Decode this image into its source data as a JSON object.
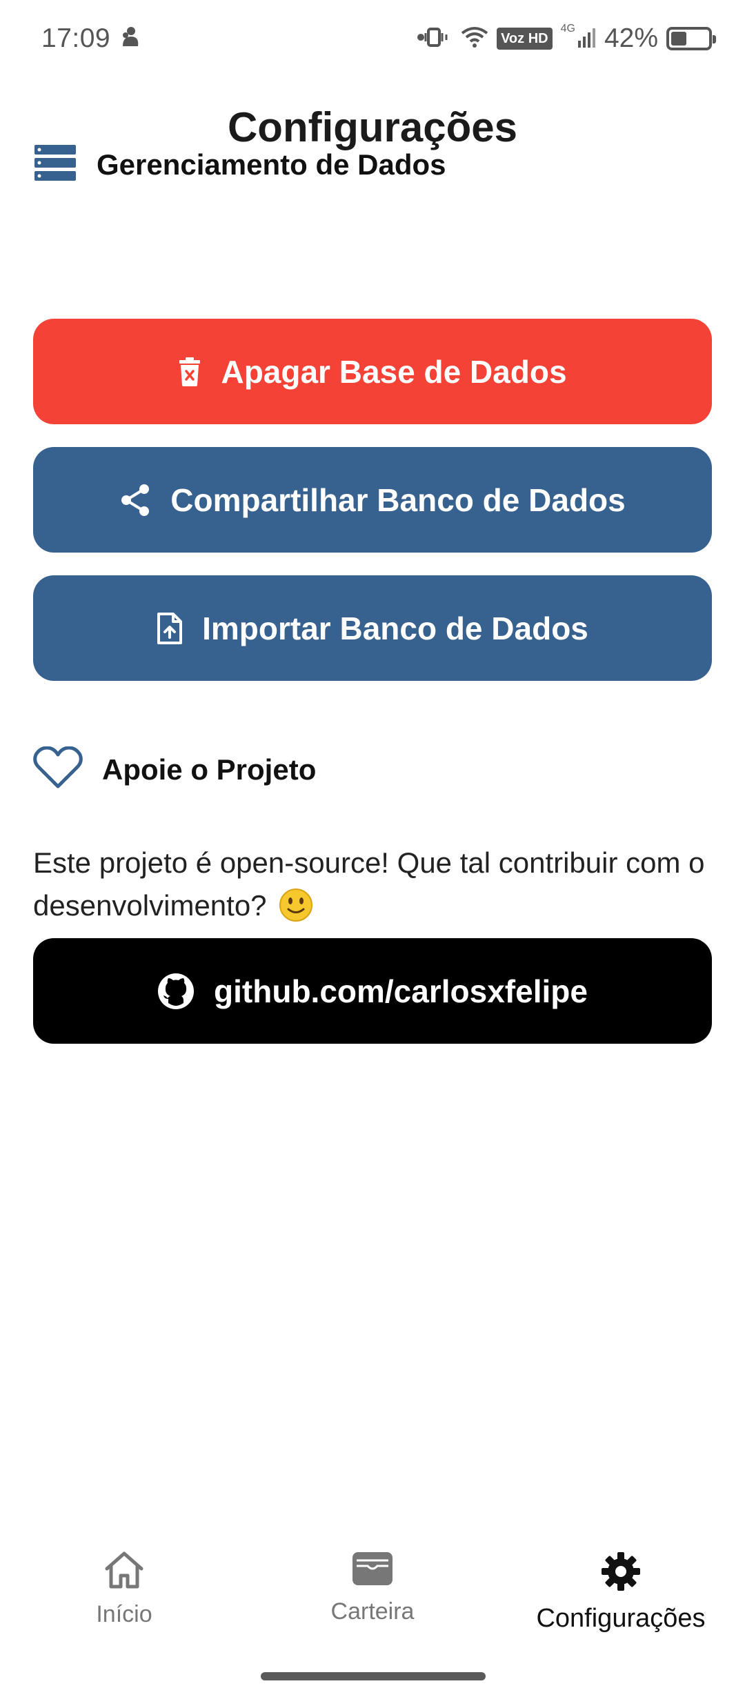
{
  "status_bar": {
    "time": "17:09",
    "network_type": "4G",
    "voz_label": "Voz HD",
    "battery_percent": "42%",
    "battery_level": 0.42
  },
  "header": {
    "title": "Configurações"
  },
  "data_section": {
    "title": "Gerenciamento de Dados",
    "icon": "database-icon",
    "buttons": [
      {
        "label": "Apagar Base de Dados",
        "icon": "trash-icon",
        "color": "#F44336"
      },
      {
        "label": "Compartilhar Banco de Dados",
        "icon": "share-icon",
        "color": "#37628F"
      },
      {
        "label": "Importar Banco de Dados",
        "icon": "file-upload-icon",
        "color": "#37628F"
      }
    ]
  },
  "support_section": {
    "title": "Apoie o Projeto",
    "icon": "heart-icon",
    "description": "Este projeto é open-source! Que tal contribuir com o desenvolvimento?",
    "github_button": {
      "label": "github.com/carlosxfelipe",
      "icon": "github-icon",
      "color": "#000000"
    }
  },
  "bottom_nav": {
    "items": [
      {
        "label": "Início",
        "icon": "home-icon",
        "active": false
      },
      {
        "label": "Carteira",
        "icon": "wallet-icon",
        "active": false
      },
      {
        "label": "Configurações",
        "icon": "gear-icon",
        "active": true
      }
    ]
  },
  "colors": {
    "accent": "#37628F",
    "danger": "#F44336",
    "github": "#000000"
  }
}
